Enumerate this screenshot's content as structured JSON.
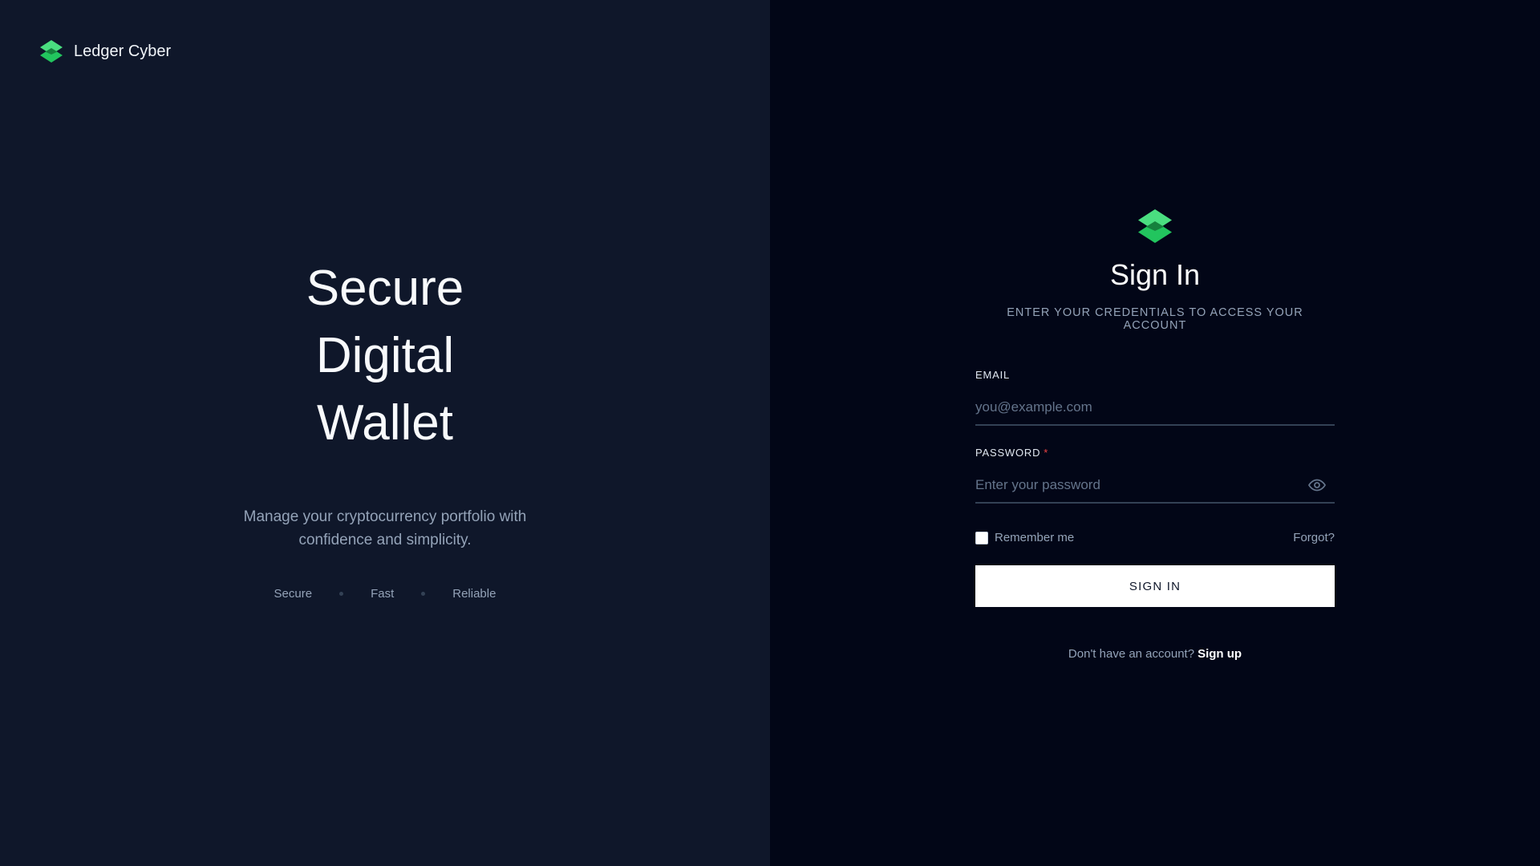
{
  "brand": {
    "name": "Ledger Cyber",
    "logo_icon": "layers-icon",
    "accent_color": "#22c55e",
    "accent_light": "#4ade80",
    "accent_dark": "#15803d"
  },
  "hero": {
    "title_lines": [
      "Secure",
      "Digital",
      "Wallet"
    ],
    "description": "Manage your cryptocurrency portfolio with confidence and simplicity.",
    "features": [
      "Secure",
      "Fast",
      "Reliable"
    ]
  },
  "form": {
    "title": "Sign In",
    "subtitle": "ENTER YOUR CREDENTIALS TO ACCESS YOUR ACCOUNT",
    "email": {
      "label": "EMAIL",
      "placeholder": "you@example.com",
      "value": ""
    },
    "password": {
      "label": "PASSWORD",
      "required_mark": "*",
      "placeholder": "Enter your password",
      "value": "",
      "toggle_icon": "eye-icon"
    },
    "remember_label": "Remember me",
    "remember_checked": false,
    "forgot_label": "Forgot?",
    "submit_label": "SIGN IN",
    "signup_prompt": "Don't have an account?",
    "signup_link": "Sign up"
  }
}
